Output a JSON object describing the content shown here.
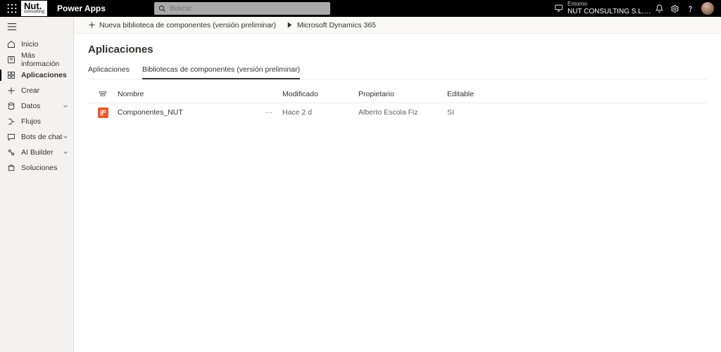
{
  "header": {
    "logo_big": "Nut.",
    "logo_small": "consulting",
    "app_name": "Power Apps",
    "search_placeholder": "Buscar",
    "env_label": "Entorno",
    "env_value": "NUT CONSULTING S.L. (..."
  },
  "sidebar": {
    "items": [
      {
        "label": "Inicio"
      },
      {
        "label": "Más información"
      },
      {
        "label": "Aplicaciones"
      },
      {
        "label": "Crear"
      },
      {
        "label": "Datos"
      },
      {
        "label": "Flujos"
      },
      {
        "label": "Bots de chat"
      },
      {
        "label": "AI Builder"
      },
      {
        "label": "Soluciones"
      }
    ]
  },
  "cmdbar": {
    "new_library": "Nueva biblioteca de componentes (versión preliminar)",
    "dynamics": "Microsoft Dynamics 365"
  },
  "page": {
    "title": "Aplicaciones",
    "tabs": {
      "apps": "Aplicaciones",
      "libs": "Bibliotecas de componentes (versión preliminar)"
    }
  },
  "grid": {
    "headers": {
      "name": "Nombre",
      "modified": "Modificado",
      "owner": "Propietario",
      "editable": "Editable"
    },
    "rows": [
      {
        "name": "Componentes_NUT",
        "modified": "Hace 2 d",
        "owner": "Alberto Escola Fiz",
        "editable": "Sí"
      }
    ]
  }
}
